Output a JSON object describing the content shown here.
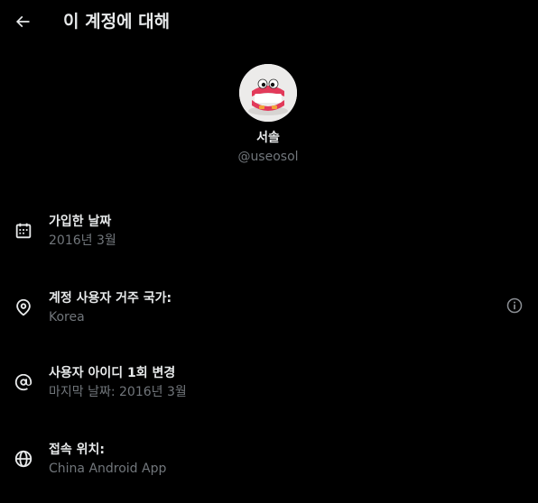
{
  "header": {
    "back_icon": "arrow-left-icon",
    "title": "이 계정에 대해"
  },
  "profile": {
    "avatar_icon": "chattering-teeth-toy-avatar",
    "display_name": "서솔",
    "username": "@useosol"
  },
  "details": [
    {
      "icon": "calendar-icon",
      "label": "가입한 날짜",
      "value": "2016년 3월"
    },
    {
      "icon": "location-pin-icon",
      "label": "계정 사용자 거주 국가:",
      "value": "Korea",
      "info_icon": "info-circle-icon"
    },
    {
      "icon": "at-sign-icon",
      "label": "사용자 아이디 1회 변경",
      "value": "마지막 날짜: 2016년 3월"
    },
    {
      "icon": "globe-icon",
      "label": "접속 위치:",
      "value": "China Android App"
    }
  ],
  "colors": {
    "background": "#000000",
    "primary_text": "#e7e9ea",
    "secondary_text": "#71767b"
  }
}
